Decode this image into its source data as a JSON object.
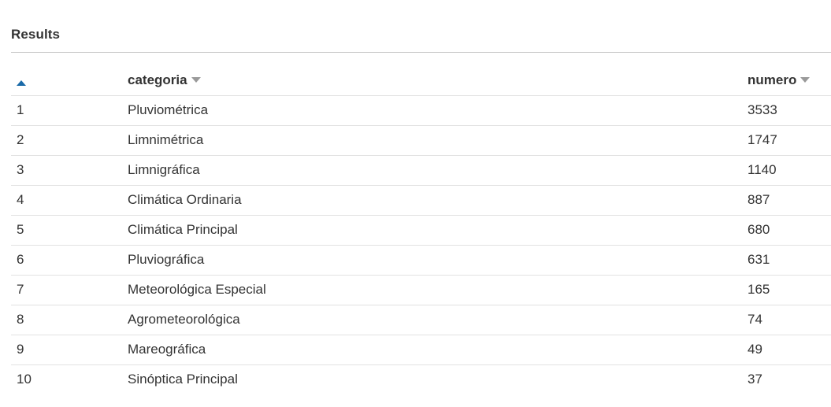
{
  "panel": {
    "title": "Results"
  },
  "table": {
    "columns": [
      {
        "key": "index",
        "label": "",
        "sort": "ascending",
        "sort_color": "#1a6aa8"
      },
      {
        "key": "categoria",
        "label": "categoria",
        "sort": "none"
      },
      {
        "key": "numero",
        "label": "numero",
        "sort": "none"
      }
    ],
    "rows": [
      {
        "index": "1",
        "categoria": "Pluviométrica",
        "numero": "3533"
      },
      {
        "index": "2",
        "categoria": "Limnimétrica",
        "numero": "1747"
      },
      {
        "index": "3",
        "categoria": "Limnigráfica",
        "numero": "1140"
      },
      {
        "index": "4",
        "categoria": "Climática Ordinaria",
        "numero": "887"
      },
      {
        "index": "5",
        "categoria": "Climática Principal",
        "numero": "680"
      },
      {
        "index": "6",
        "categoria": "Pluviográfica",
        "numero": "631"
      },
      {
        "index": "7",
        "categoria": "Meteorológica Especial",
        "numero": "165"
      },
      {
        "index": "8",
        "categoria": "Agrometeorológica",
        "numero": "74"
      },
      {
        "index": "9",
        "categoria": "Mareográfica",
        "numero": "49"
      },
      {
        "index": "10",
        "categoria": "Sinóptica Principal",
        "numero": "37"
      }
    ]
  }
}
